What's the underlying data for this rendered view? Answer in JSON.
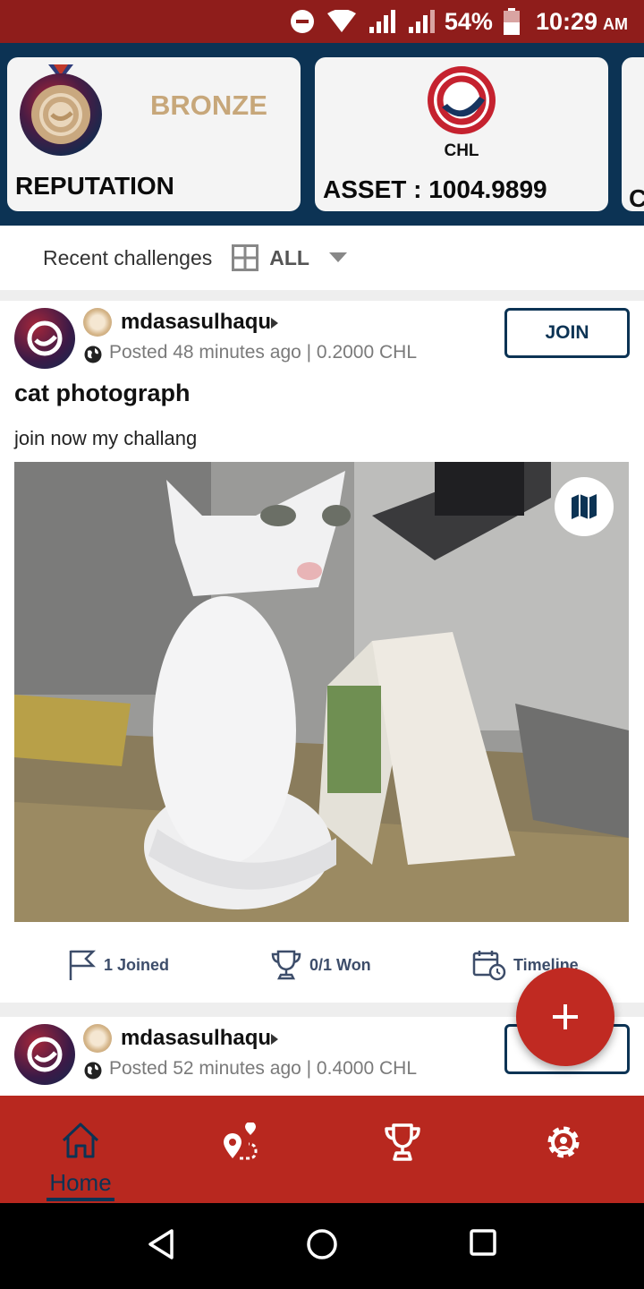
{
  "status_bar": {
    "battery": "54%",
    "time": "10:29",
    "ampm": "AM"
  },
  "header": {
    "reputation": {
      "rank": "BRONZE",
      "label": "REPUTATION"
    },
    "asset": {
      "currency": "CHL",
      "label": "ASSET : 1004.9899"
    },
    "third_card_partial": "C"
  },
  "filter": {
    "label": "Recent challenges",
    "value": "ALL"
  },
  "posts": [
    {
      "username": "mdasasulhaqu",
      "meta": "Posted 48 minutes ago | 0.2000 CHL",
      "join_label": "JOIN",
      "title": "cat photograph",
      "description": "join now my challang",
      "stats": {
        "joined": "1 Joined",
        "won": "0/1 Won",
        "timeline": "Timeline"
      }
    },
    {
      "username": "mdasasulhaqu",
      "meta": "Posted 52 minutes ago | 0.4000 CHL"
    }
  ],
  "bottom_nav": {
    "home_label": "Home"
  },
  "colors": {
    "brand_red": "#b8281f",
    "navy": "#0c3354",
    "bronze": "#c7a77a"
  }
}
